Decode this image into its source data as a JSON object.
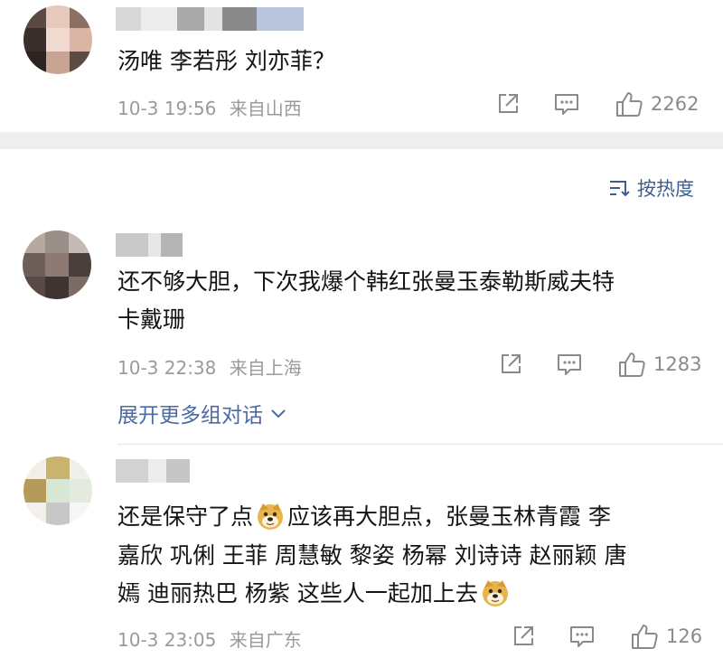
{
  "comments": [
    {
      "text_lines": [
        "汤唯 李若彤 刘亦菲？"
      ],
      "time": "10-3 19:56",
      "location": "来自山西",
      "likes": "2262"
    },
    {
      "text_lines": [
        "还不够大胆，下次我爆个韩红张曼玉泰勒斯威夫特",
        "卡戴珊"
      ],
      "time": "10-3 22:38",
      "location": "来自上海",
      "likes": "1283"
    },
    {
      "text_line1_a": "还是保守了点",
      "text_line1_b": "应该再大胆点，张曼玉林青霞 李",
      "text_line2": "嘉欣 巩俐 王菲 周慧敏 黎姿 杨幂 刘诗诗 赵丽颖 唐",
      "text_line3": "嫣 迪丽热巴 杨紫 这些人一起加上去",
      "time": "10-3 23:05",
      "location": "来自广东",
      "likes": "126"
    }
  ],
  "sort_label": "按热度",
  "expand_label": "展开更多组对话",
  "icons": {
    "share": "share-icon",
    "comment": "comment-icon",
    "like": "thumbs-up-icon",
    "sort": "sort-icon",
    "expand": "chevron-down-icon",
    "emoji": "doge-emoji-icon"
  },
  "colors": {
    "link_blue": "#4a6aa6",
    "meta_gray": "#9a9a9a",
    "separator": "#eeeeee"
  }
}
